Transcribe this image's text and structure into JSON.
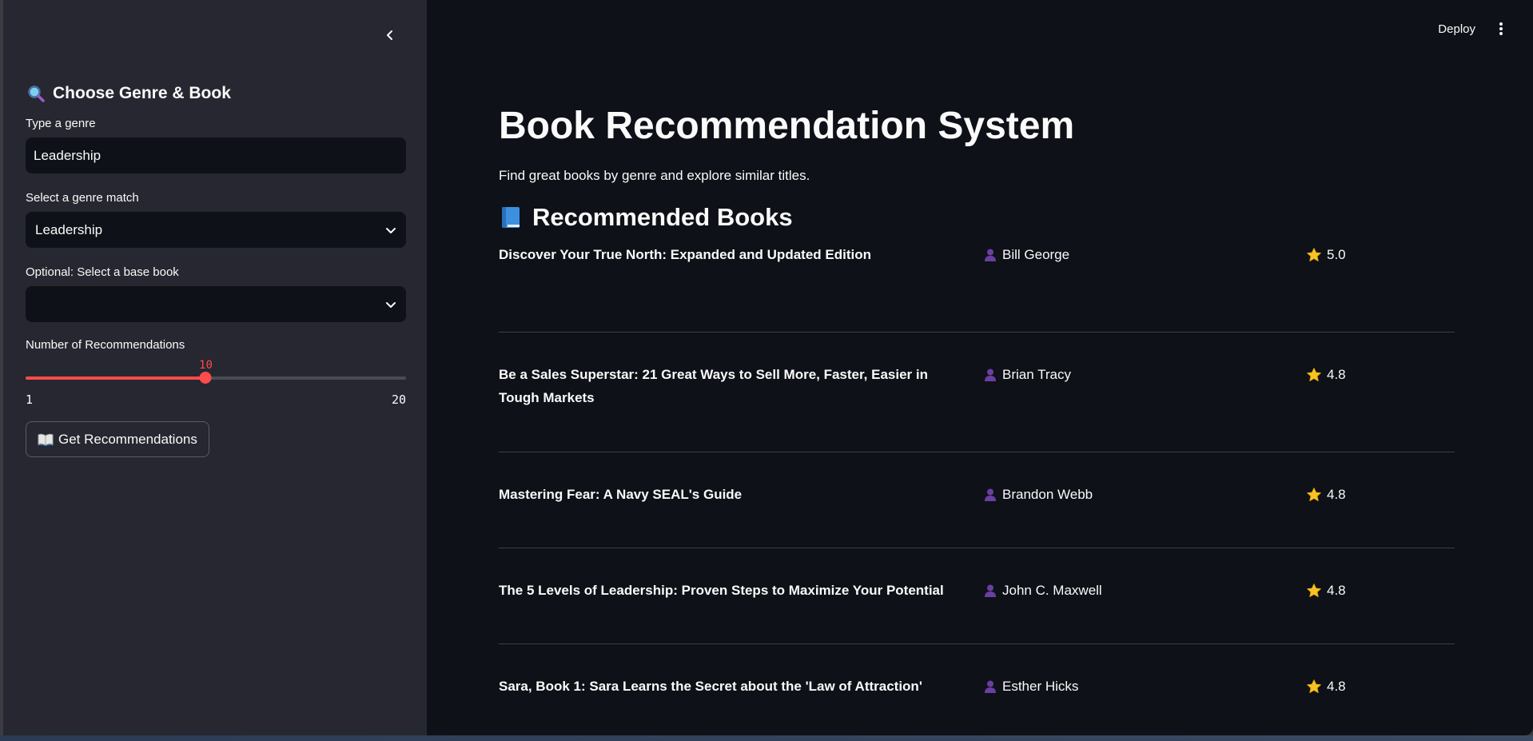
{
  "sidebar": {
    "collapse_icon": "chevron-left-icon",
    "title": "Choose Genre & Book",
    "title_icon": "magnifier-icon",
    "genre_input": {
      "label": "Type a genre",
      "value": "Leadership"
    },
    "genre_select": {
      "label": "Select a genre match",
      "value": "Leadership"
    },
    "base_book_select": {
      "label": "Optional: Select a base book",
      "value": ""
    },
    "slider": {
      "label": "Number of Recommendations",
      "value": "10",
      "min": "1",
      "max": "20"
    },
    "button": {
      "label": "Get Recommendations",
      "icon": "open-book-icon"
    }
  },
  "topbar": {
    "deploy": "Deploy",
    "menu_icon": "vertical-dots-icon"
  },
  "main": {
    "title": "Book Recommendation System",
    "subtitle": "Find great books by genre and explore similar titles.",
    "section_title": "Recommended Books",
    "section_icon": "blue-book-icon",
    "books": [
      {
        "title": "Discover Your True North: Expanded and Updated Edition",
        "author": "Bill George",
        "rating": "5.0"
      },
      {
        "title": "Be a Sales Superstar: 21 Great Ways to Sell More, Faster, Easier in Tough Markets",
        "author": "Brian Tracy",
        "rating": "4.8"
      },
      {
        "title": "Mastering Fear: A Navy SEAL's Guide",
        "author": "Brandon Webb",
        "rating": "4.8"
      },
      {
        "title": "The 5 Levels of Leadership: Proven Steps to Maximize Your Potential",
        "author": "John C. Maxwell",
        "rating": "4.8"
      },
      {
        "title": "Sara, Book 1: Sara Learns the Secret about the 'Law of Attraction'",
        "author": "Esther Hicks",
        "rating": "4.8"
      }
    ]
  },
  "colors": {
    "accent": "#ff4b4b",
    "sidebar_bg": "#262730",
    "main_bg": "#0e1117",
    "star": "#f7c325",
    "person": "#6b3fa0"
  }
}
